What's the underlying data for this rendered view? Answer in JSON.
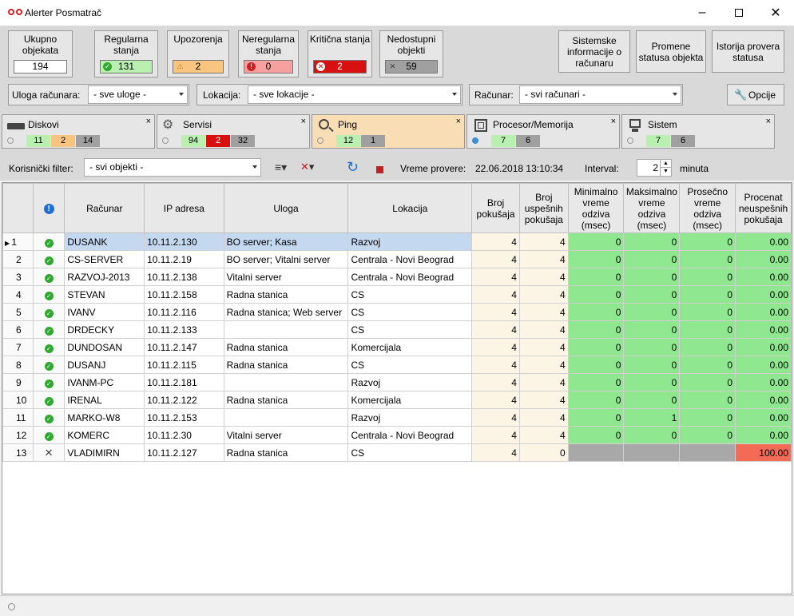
{
  "window": {
    "title": "Alerter Posmatrač"
  },
  "summary": {
    "total": {
      "label": "Ukupno objekata",
      "value": "194"
    },
    "regular": {
      "label": "Regularna stanja",
      "value": "131",
      "color": "#b9f0b0"
    },
    "warnings": {
      "label": "Upozorenja",
      "value": "2",
      "color": "#f8c580"
    },
    "irregular": {
      "label": "Neregularna stanja",
      "value": "0",
      "color": "#f7a0a0"
    },
    "critical": {
      "label": "Kritična stanja",
      "value": "2",
      "color": "#d81010"
    },
    "unavailable": {
      "label": "Nedostupni objekti",
      "value": "59",
      "color": "#a0a0a0"
    }
  },
  "buttons": {
    "system_info": "Sistemske informacije o računaru",
    "status_changes": "Promene statusa objekta",
    "status_history": "Istorija provera statusa",
    "options": "Opcije"
  },
  "filters": {
    "role_label": "Uloga računara:",
    "role_value": "- sve uloge -",
    "location_label": "Lokacija:",
    "location_value": "- sve lokacije -",
    "computer_label": "Računar:",
    "computer_value": "- svi računari -"
  },
  "tabs": [
    {
      "name": "Diskovi",
      "counts": [
        "11",
        "2",
        "14"
      ]
    },
    {
      "name": "Servisi",
      "counts": [
        "94",
        "2",
        "32"
      ]
    },
    {
      "name": "Ping",
      "counts": [
        "12",
        "1"
      ]
    },
    {
      "name": "Procesor/Memorija",
      "counts": [
        "7",
        "6"
      ]
    },
    {
      "name": "Sistem",
      "counts": [
        "7",
        "6"
      ]
    }
  ],
  "toolbar": {
    "user_filter_label": "Korisnički filter:",
    "user_filter_value": "- svi objekti -",
    "check_time_label": "Vreme provere:",
    "check_time_value": "22.06.2018 13:10:34",
    "interval_label": "Interval:",
    "interval_value": "2",
    "interval_unit": "minuta"
  },
  "columns": [
    "",
    "",
    "Računar",
    "IP adresa",
    "Uloga",
    "Lokacija",
    "Broj pokušaja",
    "Broj uspešnih pokušaja",
    "Minimalno vreme odziva (msec)",
    "Maksimalno vreme odziva (msec)",
    "Prosečno vreme odziva (msec)",
    "Procenat neuspešnih pokušaja"
  ],
  "rows": [
    {
      "n": "1",
      "status": "ok",
      "computer": "DUSANK",
      "ip": "10.11.2.130",
      "role": "BO server; Kasa",
      "location": "Razvoj",
      "attempts": "4",
      "success": "4",
      "min": "0",
      "max": "0",
      "avg": "0",
      "fail": "0.00"
    },
    {
      "n": "2",
      "status": "ok",
      "computer": "CS-SERVER",
      "ip": "10.11.2.19",
      "role": "BO server; Vitalni server",
      "location": "Centrala - Novi Beograd",
      "attempts": "4",
      "success": "4",
      "min": "0",
      "max": "0",
      "avg": "0",
      "fail": "0.00"
    },
    {
      "n": "3",
      "status": "ok",
      "computer": "RAZVOJ-2013",
      "ip": "10.11.2.138",
      "role": "Vitalni server",
      "location": "Centrala - Novi Beograd",
      "attempts": "4",
      "success": "4",
      "min": "0",
      "max": "0",
      "avg": "0",
      "fail": "0.00"
    },
    {
      "n": "4",
      "status": "ok",
      "computer": "STEVAN",
      "ip": "10.11.2.158",
      "role": "Radna stanica",
      "location": "CS",
      "attempts": "4",
      "success": "4",
      "min": "0",
      "max": "0",
      "avg": "0",
      "fail": "0.00"
    },
    {
      "n": "5",
      "status": "ok",
      "computer": "IVANV",
      "ip": "10.11.2.116",
      "role": "Radna stanica; Web server",
      "location": "CS",
      "attempts": "4",
      "success": "4",
      "min": "0",
      "max": "0",
      "avg": "0",
      "fail": "0.00"
    },
    {
      "n": "6",
      "status": "ok",
      "computer": "DRDECKY",
      "ip": "10.11.2.133",
      "role": "",
      "location": "CS",
      "attempts": "4",
      "success": "4",
      "min": "0",
      "max": "0",
      "avg": "0",
      "fail": "0.00"
    },
    {
      "n": "7",
      "status": "ok",
      "computer": "DUNDOSAN",
      "ip": "10.11.2.147",
      "role": "Radna stanica",
      "location": "Komercijala",
      "attempts": "4",
      "success": "4",
      "min": "0",
      "max": "0",
      "avg": "0",
      "fail": "0.00"
    },
    {
      "n": "8",
      "status": "ok",
      "computer": "DUSANJ",
      "ip": "10.11.2.115",
      "role": "Radna stanica",
      "location": "CS",
      "attempts": "4",
      "success": "4",
      "min": "0",
      "max": "0",
      "avg": "0",
      "fail": "0.00"
    },
    {
      "n": "9",
      "status": "ok",
      "computer": "IVANM-PC",
      "ip": "10.11.2.181",
      "role": "",
      "location": "Razvoj",
      "attempts": "4",
      "success": "4",
      "min": "0",
      "max": "0",
      "avg": "0",
      "fail": "0.00"
    },
    {
      "n": "10",
      "status": "ok",
      "computer": "IRENAL",
      "ip": "10.11.2.122",
      "role": "Radna stanica",
      "location": "Komercijala",
      "attempts": "4",
      "success": "4",
      "min": "0",
      "max": "0",
      "avg": "0",
      "fail": "0.00"
    },
    {
      "n": "11",
      "status": "ok",
      "computer": "MARKO-W8",
      "ip": "10.11.2.153",
      "role": "",
      "location": "Razvoj",
      "attempts": "4",
      "success": "4",
      "min": "0",
      "max": "1",
      "avg": "0",
      "fail": "0.00"
    },
    {
      "n": "12",
      "status": "ok",
      "computer": "KOMERC",
      "ip": "10.11.2.30",
      "role": "Vitalni server",
      "location": "Centrala - Novi Beograd",
      "attempts": "4",
      "success": "4",
      "min": "0",
      "max": "0",
      "avg": "0",
      "fail": "0.00"
    },
    {
      "n": "13",
      "status": "fail",
      "computer": "VLADIMIRN",
      "ip": "10.11.2.127",
      "role": "Radna stanica",
      "location": "CS",
      "attempts": "4",
      "success": "0",
      "min": "",
      "max": "",
      "avg": "",
      "fail": "100.00"
    }
  ]
}
